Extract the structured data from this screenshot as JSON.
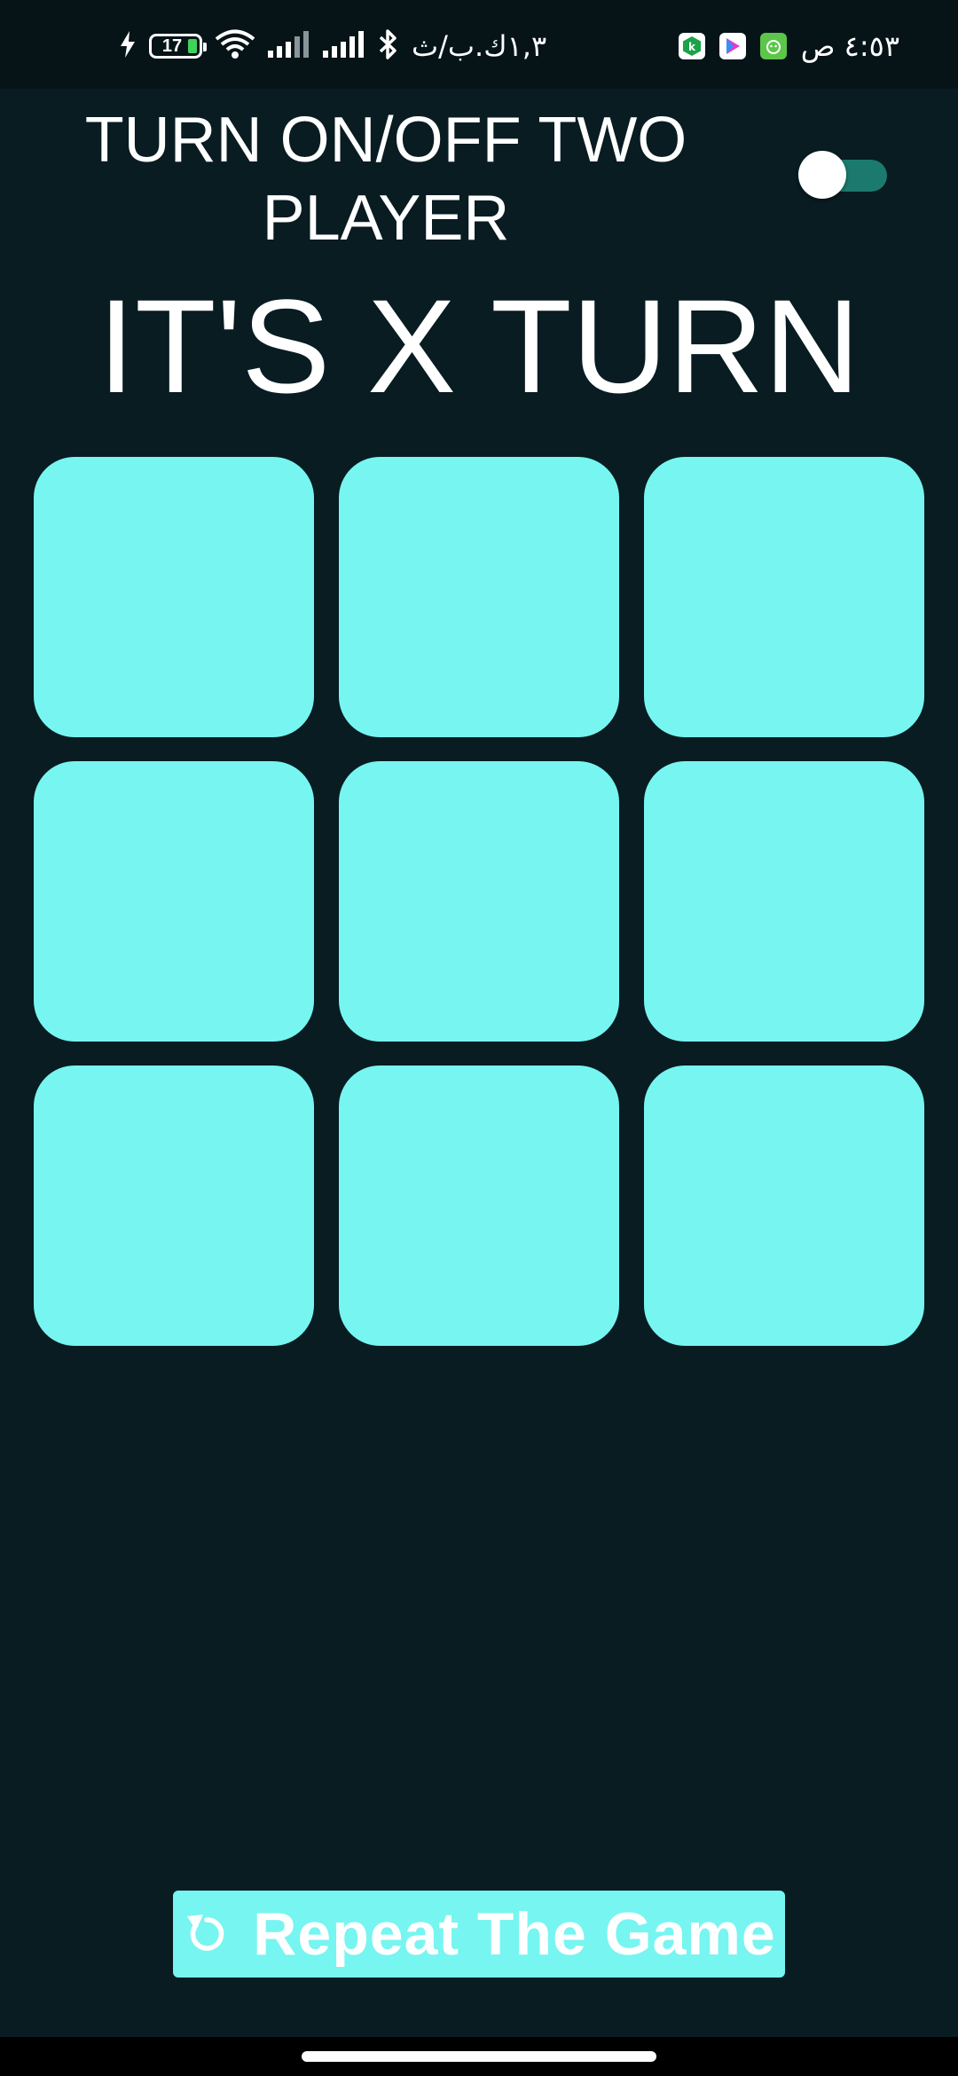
{
  "status_bar": {
    "data_usage": "١,٣ك.ب/ث",
    "battery_level": "17",
    "time": "٤:٥٣ ص",
    "icons": [
      "charging-bolt-icon",
      "battery-icon",
      "wifi-icon",
      "signal-icon",
      "signal-icon",
      "bluetooth-icon",
      "app-notification-icon",
      "play-store-icon",
      "app-notification-icon"
    ]
  },
  "header": {
    "two_player_label": "TURN ON/OFF TWO PLAYER",
    "two_player_enabled": true
  },
  "game": {
    "turn_label": "IT'S X TURN",
    "board": [
      "",
      "",
      "",
      "",
      "",
      "",
      "",
      "",
      ""
    ]
  },
  "actions": {
    "repeat_label": "Repeat The Game",
    "repeat_icon": "restart-icon"
  },
  "colors": {
    "background": "#081c22",
    "cell": "#77f5f1",
    "toggle_track": "#1b7a6d",
    "text": "#ffffff"
  }
}
